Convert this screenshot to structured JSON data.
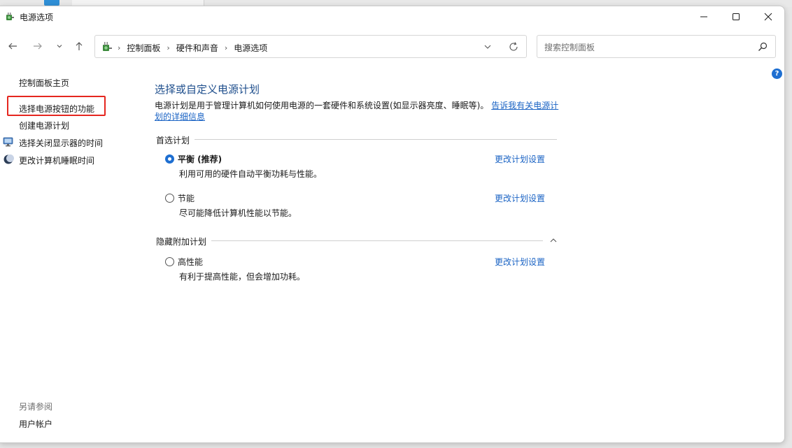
{
  "window": {
    "title": "电源选项"
  },
  "nav": {
    "back_icon": "arrow-left-icon",
    "forward_icon": "arrow-right-icon",
    "recent_icon": "chevron-down-icon",
    "up_icon": "arrow-up-icon"
  },
  "address": {
    "crumbs": [
      "控制面板",
      "硬件和声音",
      "电源选项"
    ]
  },
  "search": {
    "placeholder": "搜索控制面板"
  },
  "help": {
    "label": "?"
  },
  "sidebar": {
    "home": "控制面板主页",
    "items": [
      {
        "label": "选择电源按钮的功能",
        "icon": ""
      },
      {
        "label": "创建电源计划",
        "icon": ""
      },
      {
        "label": "选择关闭显示器的时间",
        "icon": "monitor-icon"
      },
      {
        "label": "更改计算机睡眠时间",
        "icon": "moon-icon"
      }
    ],
    "see_also_label": "另请参阅",
    "see_also_items": [
      "用户帐户"
    ]
  },
  "main": {
    "title": "选择或自定义电源计划",
    "description": "电源计划是用于管理计算机如何使用电源的一套硬件和系统设置(如显示器亮度、睡眠等)。",
    "description_link": "告诉我有关电源计划的详细信息",
    "preferred_header": "首选计划",
    "hidden_header": "隐藏附加计划",
    "plans": [
      {
        "name": "平衡 (推荐)",
        "desc": "利用可用的硬件自动平衡功耗与性能。",
        "link": "更改计划设置",
        "selected": true
      },
      {
        "name": "节能",
        "desc": "尽可能降低计算机性能以节能。",
        "link": "更改计划设置",
        "selected": false
      }
    ],
    "hidden_plans": [
      {
        "name": "高性能",
        "desc": "有利于提高性能，但会增加功耗。",
        "link": "更改计划设置",
        "selected": false
      }
    ]
  },
  "colors": {
    "accent": "#1e6fd1",
    "link": "#1a63c4",
    "title": "#1e4e8c",
    "highlight": "#e5261f"
  }
}
